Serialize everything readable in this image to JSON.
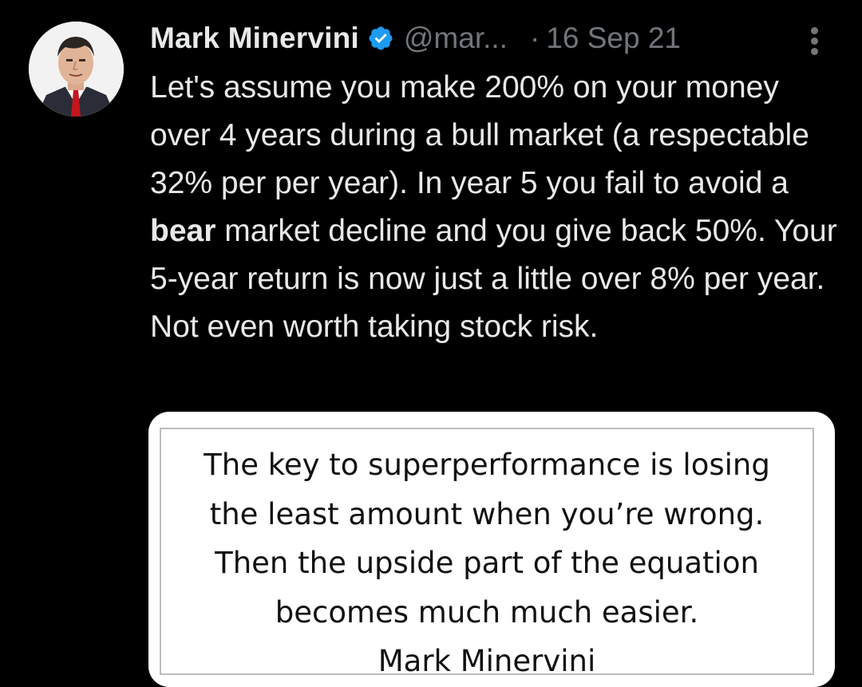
{
  "tweet": {
    "author_name": "Mark Minervini",
    "handle": "@mar...",
    "separator": "·",
    "date": "16 Sep 21",
    "verified_color": "#1d9bf0",
    "body_parts": [
      "Let's assume you make 200% on your money over 4 years during a bull market (a respectable 32% per per year). In year 5 you fail to avoid a ",
      "bear",
      " market decline and you give back 50%. Your 5-year return is now just a little over 8% per year. Not even worth taking stock risk."
    ],
    "avatar_icon": "avatar-portrait",
    "more_icon": "more-vertical-icon"
  },
  "media": {
    "quote_lines": [
      "The key to superperformance is losing",
      "the least amount when you’re wrong.",
      "Then the upside part of the equation",
      "becomes much much easier.",
      "Mark Minervini"
    ]
  }
}
